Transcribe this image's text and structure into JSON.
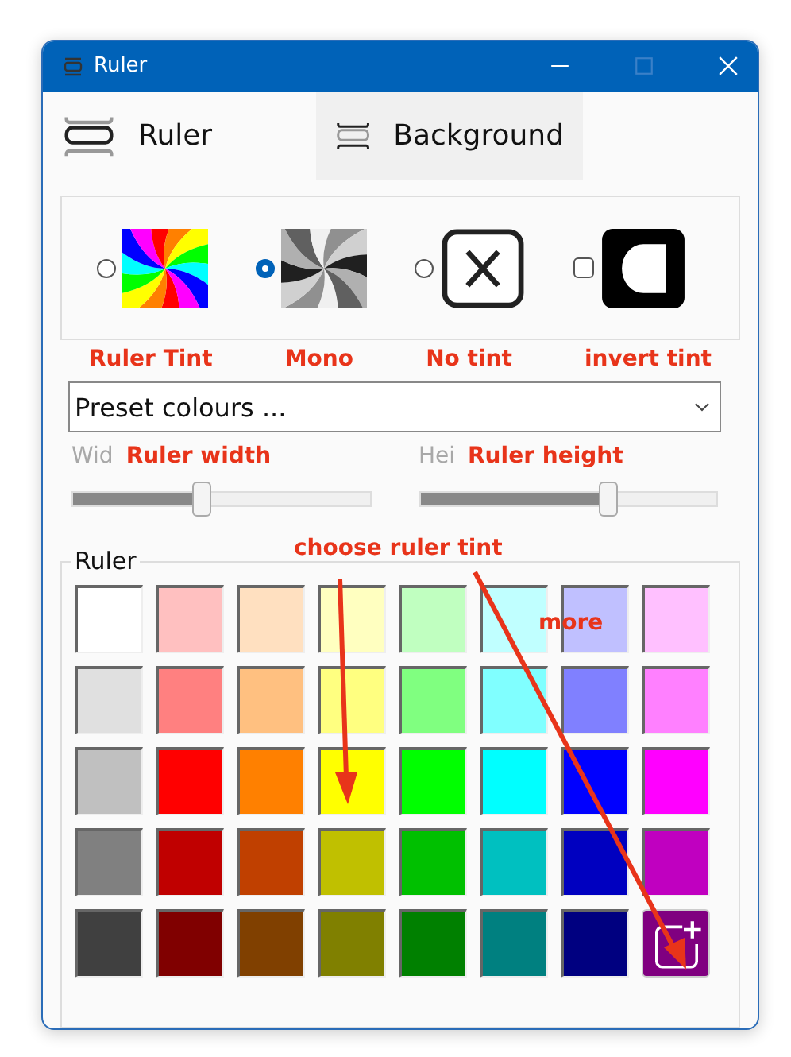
{
  "window": {
    "title": "Ruler"
  },
  "tabs": [
    {
      "label": "Ruler",
      "selected": true
    },
    {
      "label": "Background",
      "selected": false
    }
  ],
  "tint_options": [
    {
      "kind": "rainbow",
      "selected": false
    },
    {
      "kind": "mono",
      "selected": true
    },
    {
      "kind": "none",
      "selected": false
    },
    {
      "kind": "invert",
      "checked": false
    }
  ],
  "annotations": {
    "option_labels": [
      "Ruler Tint",
      "Mono",
      "No tint",
      "invert tint"
    ],
    "width": "Ruler width",
    "height": "Ruler height",
    "choose": "choose ruler tint",
    "more": "more"
  },
  "preset_dropdown": {
    "value": "Preset colours ..."
  },
  "sliders": [
    {
      "label": "Wid",
      "level": 0.43
    },
    {
      "label": "Hei",
      "level": 0.63
    }
  ],
  "ruler_group": {
    "title": "Ruler",
    "swatches": [
      {
        "kind": "color",
        "color": "#ffffff"
      },
      {
        "kind": "color",
        "color": "#ffc0c0"
      },
      {
        "kind": "color",
        "color": "#ffe0c0"
      },
      {
        "kind": "color",
        "color": "#ffffc0"
      },
      {
        "kind": "color",
        "color": "#c0ffc0"
      },
      {
        "kind": "color",
        "color": "#c0ffff"
      },
      {
        "kind": "color",
        "color": "#c0c0ff"
      },
      {
        "kind": "color",
        "color": "#ffc0ff"
      },
      {
        "kind": "color",
        "color": "#e0e0e0"
      },
      {
        "kind": "color",
        "color": "#ff8080"
      },
      {
        "kind": "color",
        "color": "#ffc080"
      },
      {
        "kind": "color",
        "color": "#ffff80"
      },
      {
        "kind": "color",
        "color": "#80ff80"
      },
      {
        "kind": "color",
        "color": "#80ffff"
      },
      {
        "kind": "color",
        "color": "#8080ff"
      },
      {
        "kind": "color",
        "color": "#ff80ff"
      },
      {
        "kind": "color",
        "color": "#c0c0c0"
      },
      {
        "kind": "color",
        "color": "#ff0000"
      },
      {
        "kind": "color",
        "color": "#ff8000"
      },
      {
        "kind": "color",
        "color": "#ffff00"
      },
      {
        "kind": "color",
        "color": "#00ff00"
      },
      {
        "kind": "color",
        "color": "#00ffff"
      },
      {
        "kind": "color",
        "color": "#0000ff"
      },
      {
        "kind": "color",
        "color": "#ff00ff"
      },
      {
        "kind": "color",
        "color": "#808080"
      },
      {
        "kind": "color",
        "color": "#c00000"
      },
      {
        "kind": "color",
        "color": "#c04000"
      },
      {
        "kind": "color",
        "color": "#c0c000"
      },
      {
        "kind": "color",
        "color": "#00c000"
      },
      {
        "kind": "color",
        "color": "#00c0c0"
      },
      {
        "kind": "color",
        "color": "#0000c0"
      },
      {
        "kind": "color",
        "color": "#c000c0"
      },
      {
        "kind": "color",
        "color": "#404040"
      },
      {
        "kind": "color",
        "color": "#800000"
      },
      {
        "kind": "color",
        "color": "#804000"
      },
      {
        "kind": "color",
        "color": "#808000"
      },
      {
        "kind": "color",
        "color": "#008000"
      },
      {
        "kind": "color",
        "color": "#008080"
      },
      {
        "kind": "color",
        "color": "#000080"
      },
      {
        "kind": "more",
        "color": "#800080"
      }
    ]
  }
}
